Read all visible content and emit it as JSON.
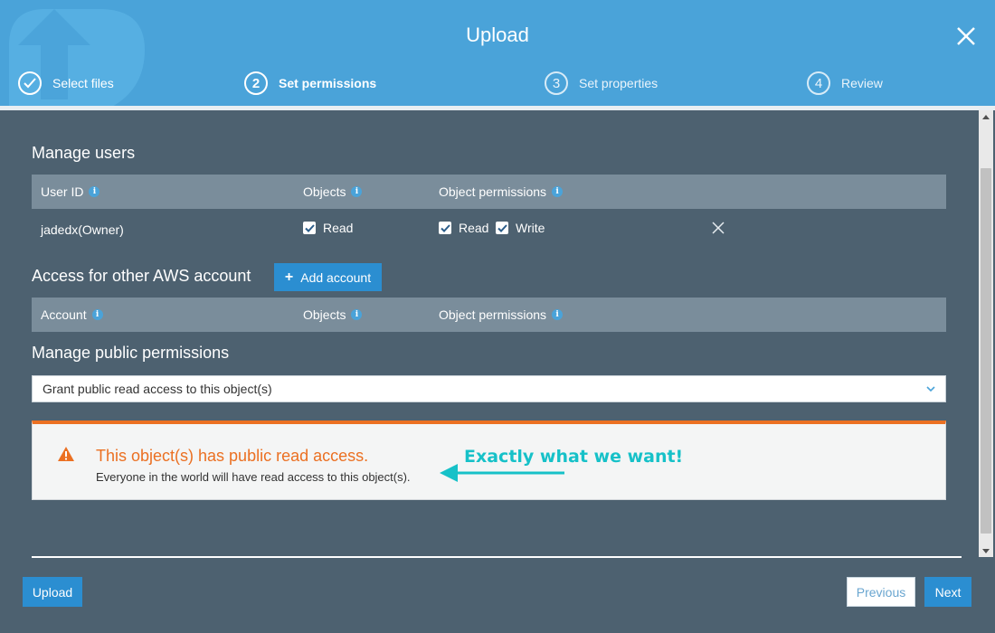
{
  "header": {
    "title": "Upload",
    "steps": [
      {
        "number": "",
        "label": "Select files",
        "state": "done"
      },
      {
        "number": "2",
        "label": "Set permissions",
        "state": "active"
      },
      {
        "number": "3",
        "label": "Set properties",
        "state": "inactive"
      },
      {
        "number": "4",
        "label": "Review",
        "state": "inactive"
      }
    ]
  },
  "manage_users": {
    "title": "Manage users",
    "columns": [
      "User ID",
      "Objects",
      "Object permissions"
    ],
    "rows": [
      {
        "user_id": "jadedx(Owner)",
        "objects_read": "Read",
        "perm_read": "Read",
        "perm_write": "Write"
      }
    ]
  },
  "other_accounts": {
    "title": "Access for other AWS account",
    "add_button": "Add account",
    "columns": [
      "Account",
      "Objects",
      "Object permissions"
    ]
  },
  "public_permissions": {
    "title": "Manage public permissions",
    "selected": "Grant public read access to this object(s)"
  },
  "alert": {
    "title": "This object(s) has public read access.",
    "body": "Everyone in the world will have read access to this object(s)."
  },
  "annotation": {
    "text": "Exactly what we want!"
  },
  "footer": {
    "upload": "Upload",
    "previous": "Previous",
    "next": "Next"
  },
  "colors": {
    "header": "#4aa3d9",
    "panel": "#4d6170",
    "table_head": "#7a8d9b",
    "primary": "#2b8ed1",
    "warning": "#eb7022",
    "annotation": "#16c1c8"
  }
}
